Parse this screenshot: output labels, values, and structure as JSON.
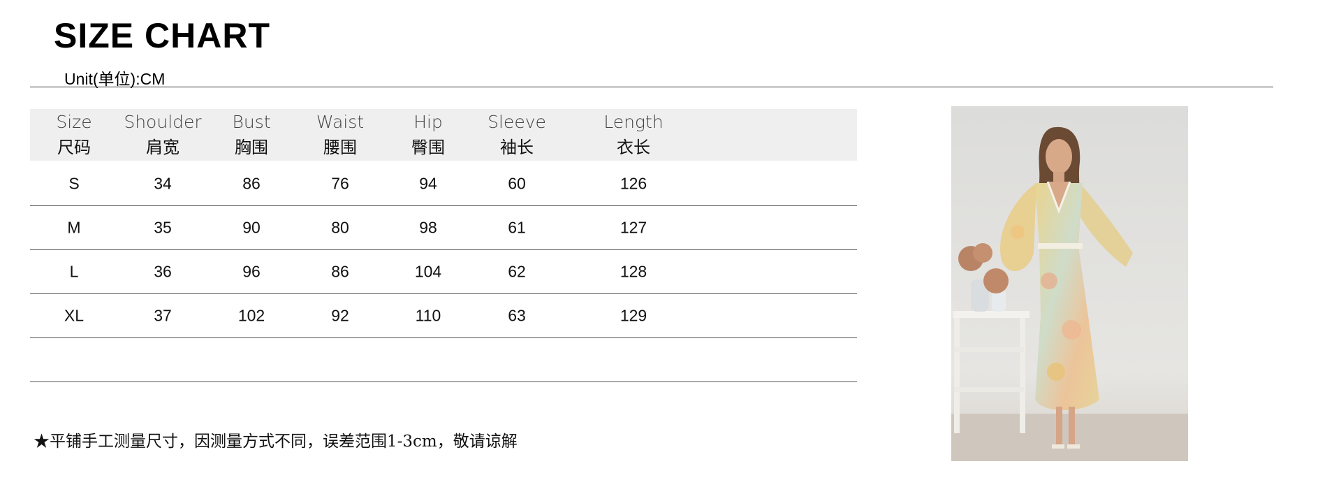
{
  "title": "SIZE CHART",
  "unit": "Unit(单位):CM",
  "columns": [
    {
      "en": "Size",
      "zh": "尺码"
    },
    {
      "en": "Shoulder",
      "zh": "肩宽"
    },
    {
      "en": "Bust",
      "zh": "胸围"
    },
    {
      "en": "Waist",
      "zh": "腰围"
    },
    {
      "en": "Hip",
      "zh": "臀围"
    },
    {
      "en": "Sleeve",
      "zh": "袖长"
    },
    {
      "en": "Length",
      "zh": "衣长"
    }
  ],
  "rows": [
    [
      "S",
      "34",
      "86",
      "76",
      "94",
      "60",
      "126"
    ],
    [
      "M",
      "35",
      "90",
      "80",
      "98",
      "61",
      "127"
    ],
    [
      "L",
      "36",
      "96",
      "86",
      "104",
      "62",
      "128"
    ],
    [
      "XL",
      "37",
      "102",
      "92",
      "110",
      "63",
      "129"
    ]
  ],
  "footnote": "★平铺手工测量尺寸，因测量方式不同，误差范围1-3cm，敬请谅解"
}
